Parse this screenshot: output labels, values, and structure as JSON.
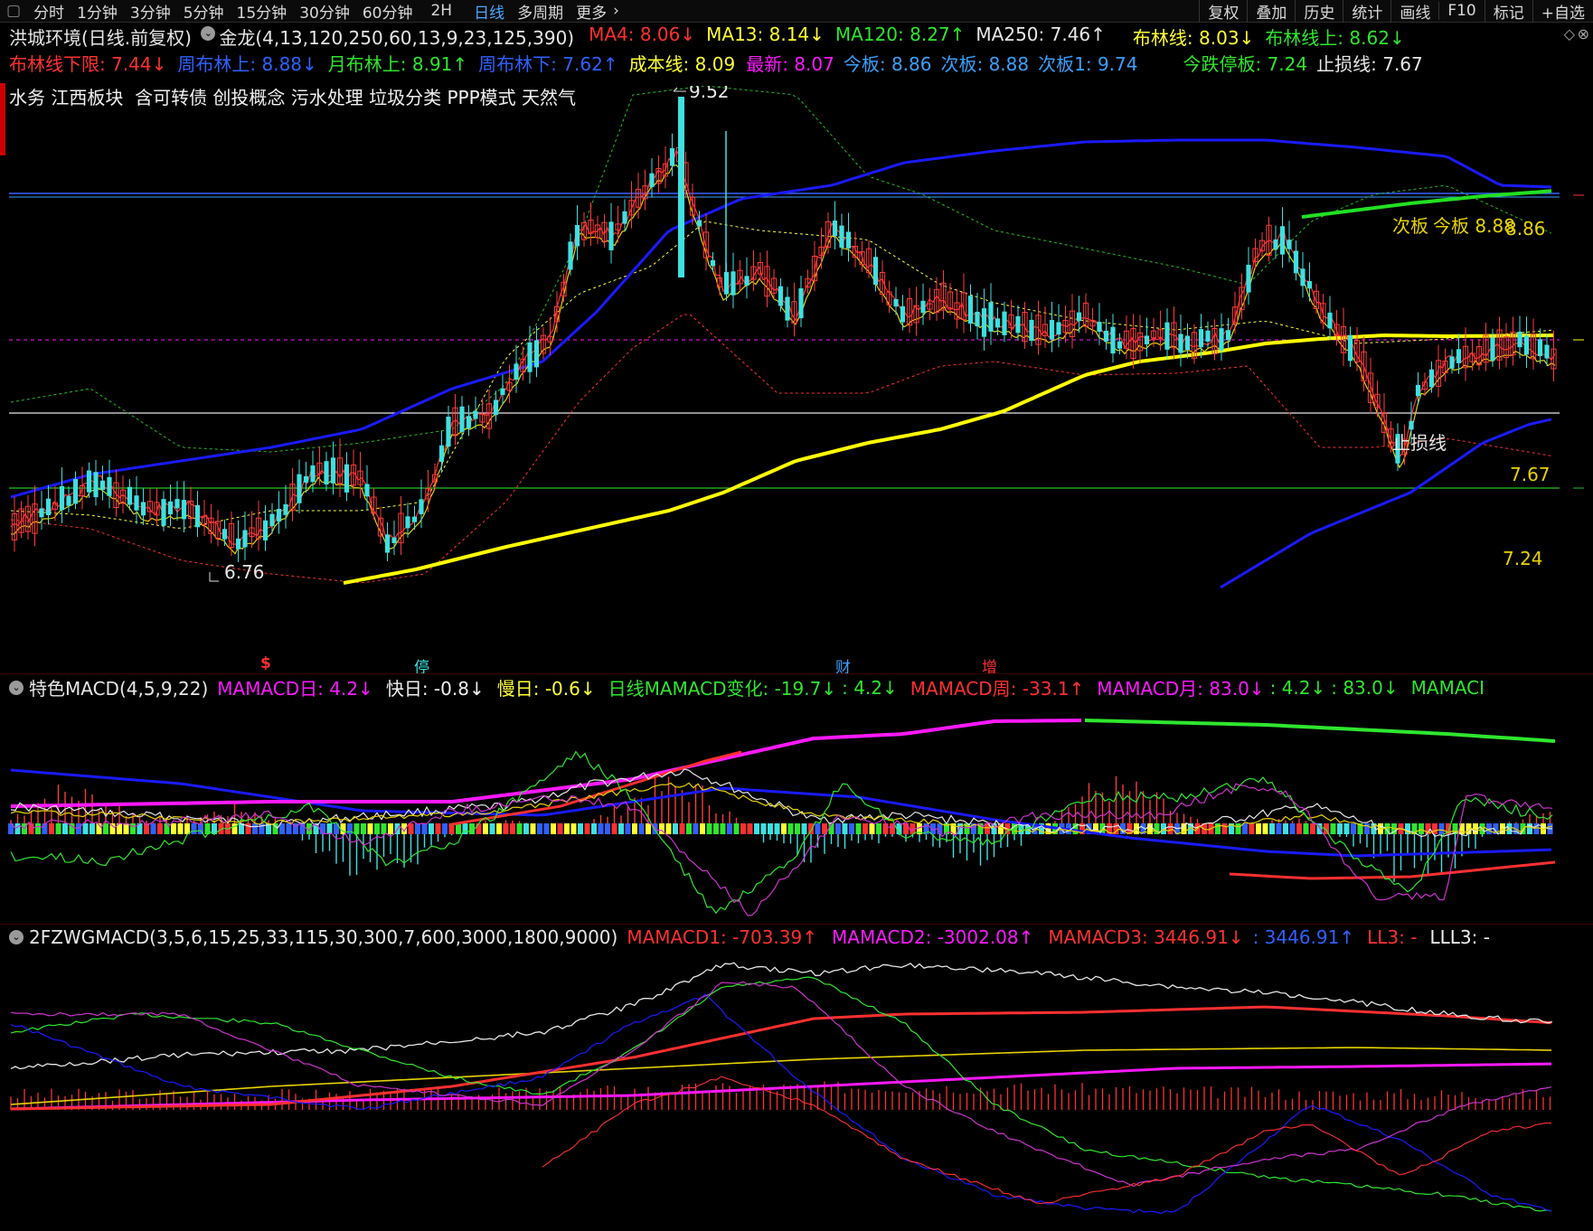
{
  "toolbar": {
    "periods": [
      "分时",
      "1分钟",
      "3分钟",
      "5分钟",
      "15分钟",
      "30分钟",
      "60分钟",
      "2H",
      "日线",
      "多周期",
      "更多"
    ],
    "active": "日线",
    "right": [
      "复权",
      "叠加",
      "历史",
      "统计",
      "画线",
      "F10",
      "标记",
      "+自选"
    ]
  },
  "header": {
    "stock": "洪城环境(日线.前复权)",
    "indicator": "金龙(4,13,120,250,60,13,9,23,125,390)",
    "ma4": "MA4: 8.06↓",
    "ma13": "MA13: 8.14↓",
    "ma120": "MA120: 8.27↑",
    "ma250": "MA250: 7.46↑",
    "boll": "布林线: 8.03↓",
    "boll_up": "布林线上: 8.62↓",
    "boll_low": "布林线下限: 7.44↓",
    "wk_boll_up": "周布林上: 8.88↓",
    "mo_boll_up": "月布林上: 8.91↑",
    "wk_boll_low": "周布林下: 7.62↑",
    "cost": "成本线: 8.09",
    "latest": "最新: 8.07",
    "today_limit": "今板: 8.86",
    "next_limit": "次板: 8.88",
    "next_limit1": "次板1: 9.74",
    "down_limit": "今跌停板: 7.24",
    "stop_loss": "止损线: 7.67",
    "concepts": "水务 江西板块  含可转债 创投概念 污水处理 垃圾分类 PPP模式 天然气"
  },
  "chart_labels": {
    "high": "9.52",
    "low": "6.76",
    "next_board": "次板",
    "today_board": "今板 8.88",
    "price_886": "8.86",
    "stoploss_text": "止损线",
    "price_767": "7.67",
    "price_724": "7.24",
    "marker_s": "$",
    "marker_stop": "停",
    "marker_cai": "财",
    "marker_zeng": "增"
  },
  "macd_panel": {
    "name": "特色MACD(4,5,9,22)",
    "day": "MAMACD日: 4.2↓",
    "fast": "快日: -0.8↓",
    "slow": "慢日: -0.6↓",
    "change": "日线MAMACD变化: -19.7↓",
    "v1": ": 4.2↓",
    "week": "MAMACD周: -33.1↑",
    "month": "MAMACD月: 83.0↓",
    "v2": ": 4.2↓",
    "v3": ": 83.0↓",
    "tail": "MAMACI"
  },
  "fz_panel": {
    "name": "2FZWGMACD(3,5,6,15,25,33,115,30,300,7,600,3000,1800,9000)",
    "m1": "MAMACD1: -703.39↑",
    "m2": "MAMACD2: -3002.08↑",
    "m3": "MAMACD3: 3446.91↓",
    "m4": ": 3446.91↑",
    "ll3": "LL3: -",
    "lll3": "LLL3: -"
  },
  "colors": {
    "up": "#ff3b3b",
    "down": "#3ee0e0",
    "ma250": "#ffff00",
    "ma120": "#1a1aff",
    "boll_green": "#1fc81f",
    "magenta": "#ff19ff",
    "green": "#2ee62e"
  }
}
